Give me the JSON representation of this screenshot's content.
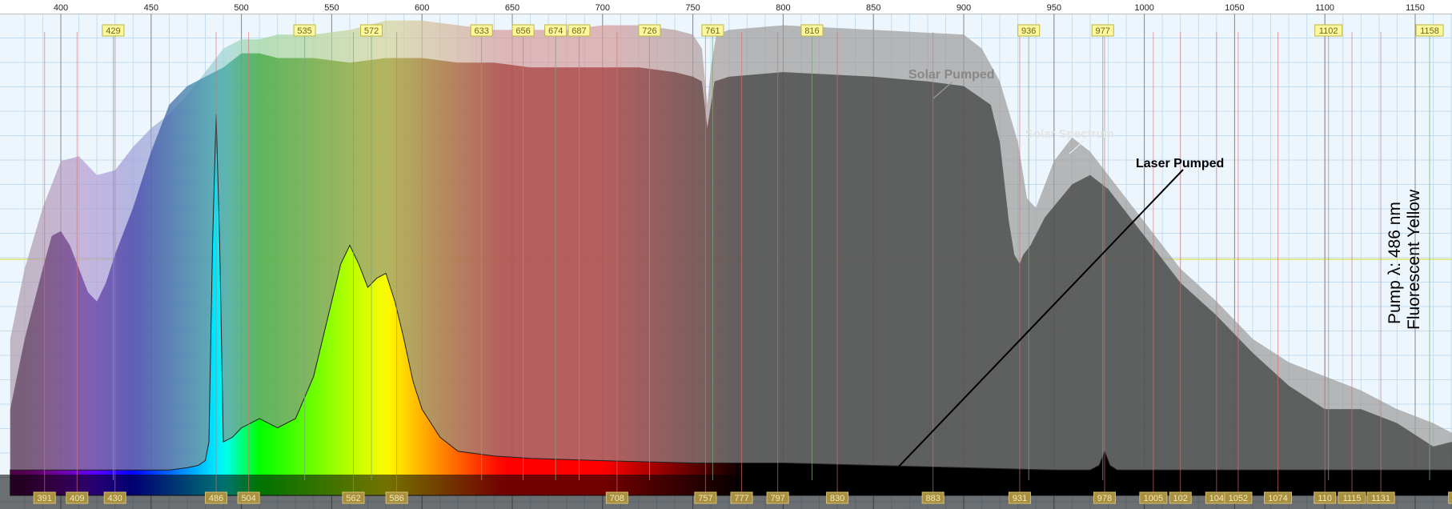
{
  "chart_data": {
    "type": "area",
    "xlim": [
      372,
      1190
    ],
    "ylim": [
      0,
      1
    ],
    "x_ticks": [
      400,
      450,
      500,
      550,
      600,
      650,
      700,
      750,
      800,
      850,
      900,
      950,
      1000,
      1050,
      1100,
      1150
    ],
    "series": [
      {
        "name": "Solar Spectrum",
        "x": [
          372,
          380,
          390,
          400,
          410,
          420,
          430,
          440,
          450,
          460,
          470,
          480,
          490,
          500,
          510,
          520,
          540,
          560,
          580,
          600,
          620,
          640,
          660,
          680,
          700,
          720,
          740,
          750,
          755,
          758,
          760,
          763,
          770,
          800,
          850,
          900,
          910,
          920,
          930,
          935,
          940,
          950,
          960,
          970,
          980,
          990,
          1000,
          1020,
          1040,
          1060,
          1080,
          1100,
          1120,
          1140,
          1160,
          1170,
          1180,
          1190
        ],
        "values": [
          0.3,
          0.45,
          0.58,
          0.68,
          0.69,
          0.65,
          0.66,
          0.71,
          0.75,
          0.78,
          0.82,
          0.87,
          0.92,
          0.94,
          0.94,
          0.95,
          0.95,
          0.96,
          0.98,
          0.98,
          0.97,
          0.96,
          0.96,
          0.96,
          0.97,
          0.97,
          0.96,
          0.95,
          0.92,
          0.8,
          0.88,
          0.95,
          0.96,
          0.97,
          0.96,
          0.95,
          0.92,
          0.85,
          0.72,
          0.6,
          0.58,
          0.68,
          0.73,
          0.7,
          0.65,
          0.6,
          0.55,
          0.45,
          0.38,
          0.3,
          0.25,
          0.22,
          0.19,
          0.15,
          0.12,
          0.1,
          0.1,
          0.08
        ]
      },
      {
        "name": "Solar Pumped",
        "x": [
          372,
          380,
          390,
          395,
          400,
          405,
          410,
          415,
          420,
          425,
          430,
          440,
          450,
          460,
          470,
          480,
          490,
          500,
          510,
          520,
          530,
          540,
          560,
          580,
          600,
          620,
          640,
          660,
          680,
          700,
          720,
          740,
          750,
          755,
          758,
          762,
          770,
          800,
          850,
          880,
          900,
          915,
          920,
          925,
          928,
          931,
          933,
          937,
          945,
          960,
          970,
          980,
          1000,
          1020,
          1040,
          1060,
          1080,
          1100,
          1120,
          1140,
          1160,
          1170,
          1180,
          1190
        ],
        "values": [
          0.15,
          0.3,
          0.45,
          0.52,
          0.53,
          0.5,
          0.45,
          0.4,
          0.38,
          0.42,
          0.48,
          0.58,
          0.7,
          0.8,
          0.84,
          0.86,
          0.88,
          0.91,
          0.91,
          0.9,
          0.9,
          0.9,
          0.89,
          0.9,
          0.9,
          0.89,
          0.89,
          0.88,
          0.88,
          0.88,
          0.88,
          0.87,
          0.86,
          0.85,
          0.75,
          0.85,
          0.86,
          0.87,
          0.86,
          0.85,
          0.84,
          0.8,
          0.72,
          0.55,
          0.48,
          0.46,
          0.48,
          0.5,
          0.56,
          0.63,
          0.65,
          0.62,
          0.52,
          0.42,
          0.35,
          0.27,
          0.2,
          0.15,
          0.15,
          0.12,
          0.07,
          0.08,
          0.06,
          0.06
        ]
      },
      {
        "name": "Laser Pumped",
        "x": [
          372,
          380,
          400,
          420,
          440,
          460,
          470,
          476,
          480,
          482,
          484,
          486,
          488,
          490,
          495,
          500,
          510,
          520,
          530,
          540,
          550,
          555,
          560,
          565,
          570,
          575,
          580,
          585,
          590,
          595,
          600,
          610,
          620,
          640,
          660,
          700,
          750,
          800,
          850,
          900,
          950,
          970,
          975,
          978,
          981,
          985,
          1000,
          1050,
          1100,
          1150,
          1190
        ],
        "values": [
          0.02,
          0.02,
          0.02,
          0.02,
          0.02,
          0.02,
          0.025,
          0.03,
          0.04,
          0.08,
          0.5,
          0.78,
          0.5,
          0.08,
          0.09,
          0.11,
          0.13,
          0.11,
          0.13,
          0.22,
          0.38,
          0.46,
          0.5,
          0.46,
          0.41,
          0.43,
          0.44,
          0.38,
          0.3,
          0.21,
          0.15,
          0.09,
          0.06,
          0.05,
          0.045,
          0.04,
          0.035,
          0.035,
          0.03,
          0.025,
          0.02,
          0.02,
          0.03,
          0.06,
          0.03,
          0.02,
          0.02,
          0.02,
          0.02,
          0.02,
          0.02
        ]
      }
    ],
    "top_peaks": [
      429,
      535,
      572,
      633,
      656,
      674,
      687,
      726,
      761,
      816,
      936,
      977,
      1102,
      1158
    ],
    "bottom_peaks": [
      391,
      409,
      430,
      486,
      504,
      562,
      586,
      708,
      757,
      777,
      797,
      830,
      883,
      931,
      978,
      1005,
      "102",
      "104",
      1052,
      1074,
      "110",
      1115,
      1131,
      1176
    ],
    "annotations": {
      "solar_pumped": "Solar Pumped",
      "solar_spectrum": "Solar Spectrum",
      "laser_pumped": "Laser Pumped",
      "pump_wavelength": "Pump λ: 486 nm",
      "sample_name": "Fluorescent Yellow"
    },
    "colors": {
      "solar_spectrum_fill": "#c8c8c8",
      "solar_pumped_fill": "#6e6e6e",
      "laser_pumped_fill": "#000000",
      "plot_background": "#eef6fd",
      "major_grid": "#888888",
      "minor_grid": "#c4dcef",
      "highlight_line": "#d9e24a"
    },
    "grid": true
  }
}
